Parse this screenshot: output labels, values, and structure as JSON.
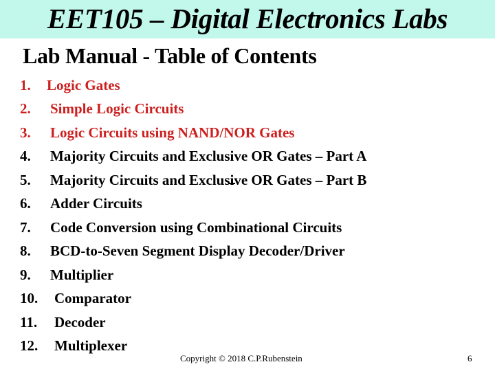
{
  "slide": {
    "title": "EET105 – Digital Electronics Labs",
    "subtitle": "Lab Manual - Table of Contents",
    "header_color": "#c2f7ec",
    "accent_color": "#cc1f1f",
    "toc": [
      {
        "number": "1.",
        "label": "Logic Gates",
        "highlighted": true
      },
      {
        "number": "2.",
        "label": "Simple Logic Circuits",
        "highlighted": true
      },
      {
        "number": "3.",
        "label": "Logic Circuits using NAND/NOR Gates",
        "highlighted": true
      },
      {
        "number": "4.",
        "label": "Majority Circuits and Exclusive OR Gates – Part A",
        "highlighted": false
      },
      {
        "number": "5.",
        "label": "Majority Circuits and Exclusive OR Gates – Part B",
        "highlighted": false
      },
      {
        "number": "6.",
        "label": "Adder Circuits",
        "highlighted": false
      },
      {
        "number": "7.",
        "label": "Code Conversion using Combinational Circuits",
        "highlighted": false
      },
      {
        "number": "8.",
        "label": "BCD-to-Seven Segment Display Decoder/Driver",
        "highlighted": false
      },
      {
        "number": "9.",
        "label": "Multiplier",
        "highlighted": false
      },
      {
        "number": "10.",
        "label": "Comparator",
        "highlighted": false
      },
      {
        "number": "11.",
        "label": "Decoder",
        "highlighted": false
      },
      {
        "number": "12.",
        "label": "Multiplexer",
        "highlighted": false
      }
    ],
    "footer": {
      "copyright": "Copyright © 2018 C.P.Rubenstein",
      "page_number": "6"
    }
  }
}
